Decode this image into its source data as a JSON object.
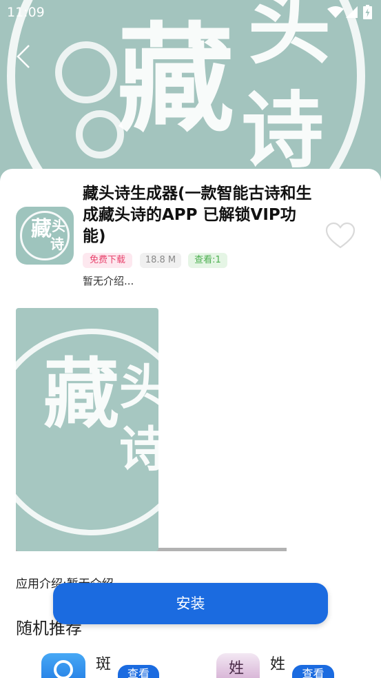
{
  "status_bar": {
    "time": "11:09"
  },
  "logo_text": {
    "c1": "藏",
    "c2": "头",
    "c3": "诗"
  },
  "app": {
    "title": "藏头诗生成器(一款智能古诗和生成藏头诗的APP 已解锁VIP功能)",
    "tags": [
      {
        "label": "免费下载",
        "color": "#e8436c"
      },
      {
        "label": "18.8 M",
        "color": "#8a8a8a"
      },
      {
        "label": "查看:1",
        "color": "#4caf50"
      }
    ],
    "short_desc": "暂无介绍..."
  },
  "intro": "应用介绍:暂无介绍",
  "install_label": "安装",
  "recommend": {
    "title": "随机推荐",
    "items": [
      {
        "name": "斑",
        "button": "查看",
        "icon": "steering-wheel-icon"
      },
      {
        "name": "姓",
        "button": "查看",
        "icon": "name-app-icon"
      }
    ]
  },
  "colors": {
    "accent": "#1b6be0",
    "header_bg": "#a3c4be"
  }
}
